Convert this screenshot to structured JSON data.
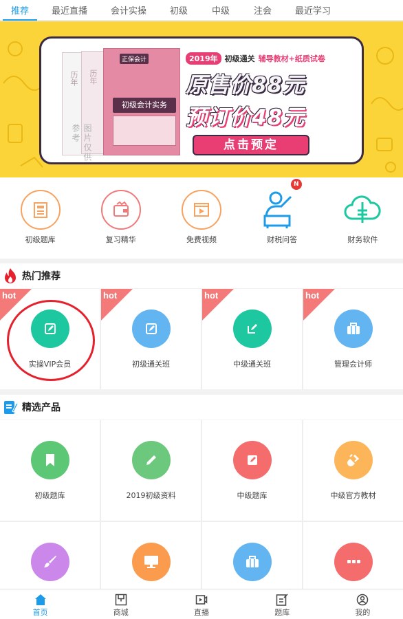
{
  "tabs": [
    {
      "label": "推荐",
      "active": true
    },
    {
      "label": "最近直播"
    },
    {
      "label": "会计实操"
    },
    {
      "label": "初级"
    },
    {
      "label": "中级"
    },
    {
      "label": "注会"
    },
    {
      "label": "最近学习"
    }
  ],
  "banner": {
    "book_spine_1": "历年",
    "book_spine_2": "历年",
    "book_brand": "正保会计",
    "book_title": "初级会计实务",
    "watermark": "图片仅供参考",
    "year": "2019年",
    "subtitle_a": "初级通关",
    "subtitle_b": "辅导教材+纸质试卷",
    "original_price": "原售价88元",
    "presale_price": "预订价48元",
    "cta": "点击预定"
  },
  "quick_links": [
    {
      "label": "初级题库",
      "icon": "question-bank-icon"
    },
    {
      "label": "复习精华",
      "icon": "wallet-icon"
    },
    {
      "label": "免费视频",
      "icon": "video-icon"
    },
    {
      "label": "财税问答",
      "icon": "person-qa-icon",
      "badge": "N"
    },
    {
      "label": "财务软件",
      "icon": "cloud-software-icon"
    }
  ],
  "hot_section": {
    "title": "热门推荐",
    "hot_tag": "hot",
    "items": [
      {
        "label": "实操VIP会员",
        "color": "#1dc7a0",
        "icon": "edit-icon"
      },
      {
        "label": "初级通关班",
        "color": "#62b5f1",
        "icon": "edit-icon"
      },
      {
        "label": "中级通关班",
        "color": "#1dc7a0",
        "icon": "edit-icon"
      },
      {
        "label": "管理会计师",
        "color": "#62b5f1",
        "icon": "briefcase-icon"
      }
    ]
  },
  "products_section": {
    "title": "精选产品",
    "items": [
      {
        "label": "初级题库",
        "color": "#5cc774",
        "icon": "bookmark-icon"
      },
      {
        "label": "2019初级资料",
        "color": "#6cc87c",
        "icon": "pencil-icon"
      },
      {
        "label": "中级题库",
        "color": "#f56c6c",
        "icon": "edit-icon"
      },
      {
        "label": "中级官方教材",
        "color": "#fdb559",
        "icon": "plug-icon"
      },
      {
        "label": "",
        "color": "#cb87ea",
        "icon": "brush-icon"
      },
      {
        "label": "",
        "color": "#fb9b4e",
        "icon": "monitor-icon"
      },
      {
        "label": "",
        "color": "#62b5f1",
        "icon": "briefcase-icon"
      },
      {
        "label": "",
        "color": "#f56c6c",
        "icon": "more-icon"
      }
    ]
  },
  "bottom_nav": [
    {
      "label": "首页",
      "active": true,
      "icon": "home-icon"
    },
    {
      "label": "商城",
      "icon": "store-icon"
    },
    {
      "label": "直播",
      "icon": "live-icon"
    },
    {
      "label": "题库",
      "icon": "exam-icon"
    },
    {
      "label": "我的",
      "icon": "profile-icon"
    }
  ],
  "colors": {
    "accent": "#1e9be8",
    "hot": "#f47a7a",
    "banner_bg": "#fbd43a",
    "annotation_ring": "#e4212c"
  }
}
